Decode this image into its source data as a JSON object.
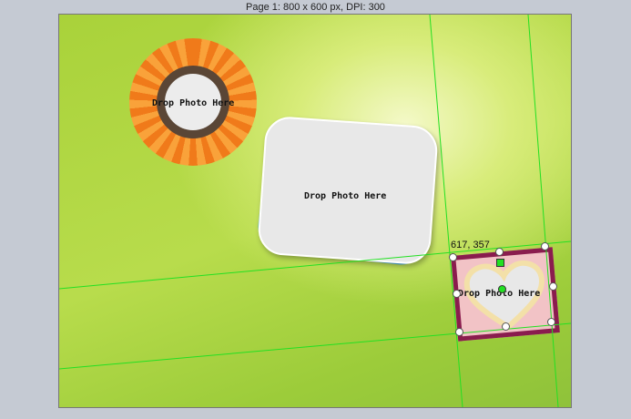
{
  "window": {
    "title": "Page 1: 800 x 600 px, DPI: 300"
  },
  "canvas": {
    "placeholders": [
      {
        "label": "Drop Photo Here",
        "frame": "sunflower"
      },
      {
        "label": "Drop Photo Here",
        "frame": "rounded-card"
      },
      {
        "label": "Drop Photo Here",
        "frame": "heart"
      }
    ],
    "selection": {
      "coordinates": "617, 357"
    },
    "guide_color": "#22e022"
  }
}
